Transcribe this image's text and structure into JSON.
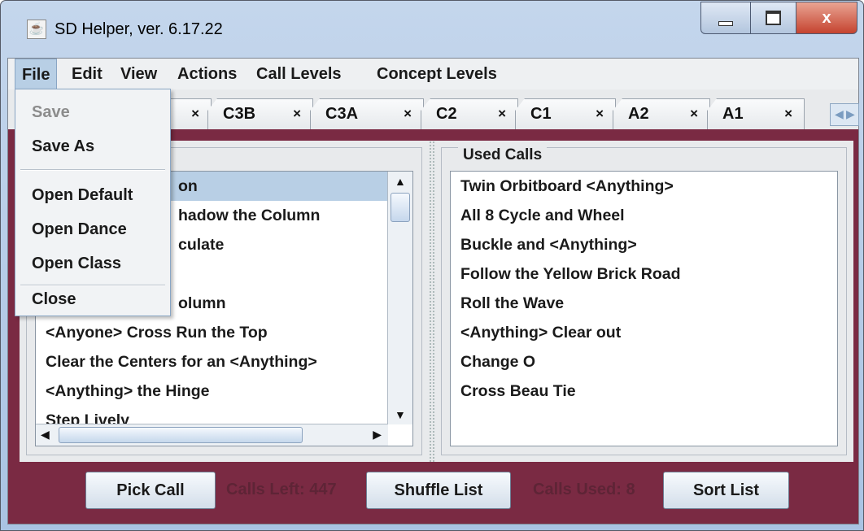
{
  "window": {
    "title": "SD Helper, ver. 6.17.22",
    "close_label": "x"
  },
  "menubar": [
    "File",
    "Edit",
    "View",
    "Actions",
    "Call Levels",
    "Concept Levels"
  ],
  "tabs": [
    {
      "label": "C3B",
      "close": "×"
    },
    {
      "label": "C3A",
      "close": "×"
    },
    {
      "label": "C2",
      "close": "×"
    },
    {
      "label": "C1",
      "close": "×"
    },
    {
      "label": "A2",
      "close": "×"
    },
    {
      "label": "A1",
      "close": "×"
    }
  ],
  "first_tab_close": "×",
  "file_menu": {
    "save": "Save",
    "save_as": "Save As",
    "open_default": "Open Default",
    "open_dance": "Open Dance",
    "open_class": "Open Class",
    "close": "Close"
  },
  "available_calls": {
    "items": [
      "on",
      "hadow the Column",
      "culate",
      "",
      "olumn",
      "<Anyone> Cross Run the Top",
      "Clear the Centers for an <Anything>",
      "<Anything> the Hinge",
      "Step Lively"
    ]
  },
  "used_calls": {
    "title": "Used Calls",
    "items": [
      "Twin Orbitboard <Anything>",
      "All 8 Cycle and Wheel",
      "Buckle and <Anything>",
      "Follow the Yellow Brick Road",
      "Roll the Wave",
      "<Anything> Clear out",
      "Change O",
      "Cross Beau Tie"
    ]
  },
  "bottom": {
    "pick_call": "Pick Call",
    "calls_left": "Calls Left: 447",
    "shuffle_list": "Shuffle List",
    "calls_used": "Calls Used: 8",
    "sort_list": "Sort List"
  }
}
